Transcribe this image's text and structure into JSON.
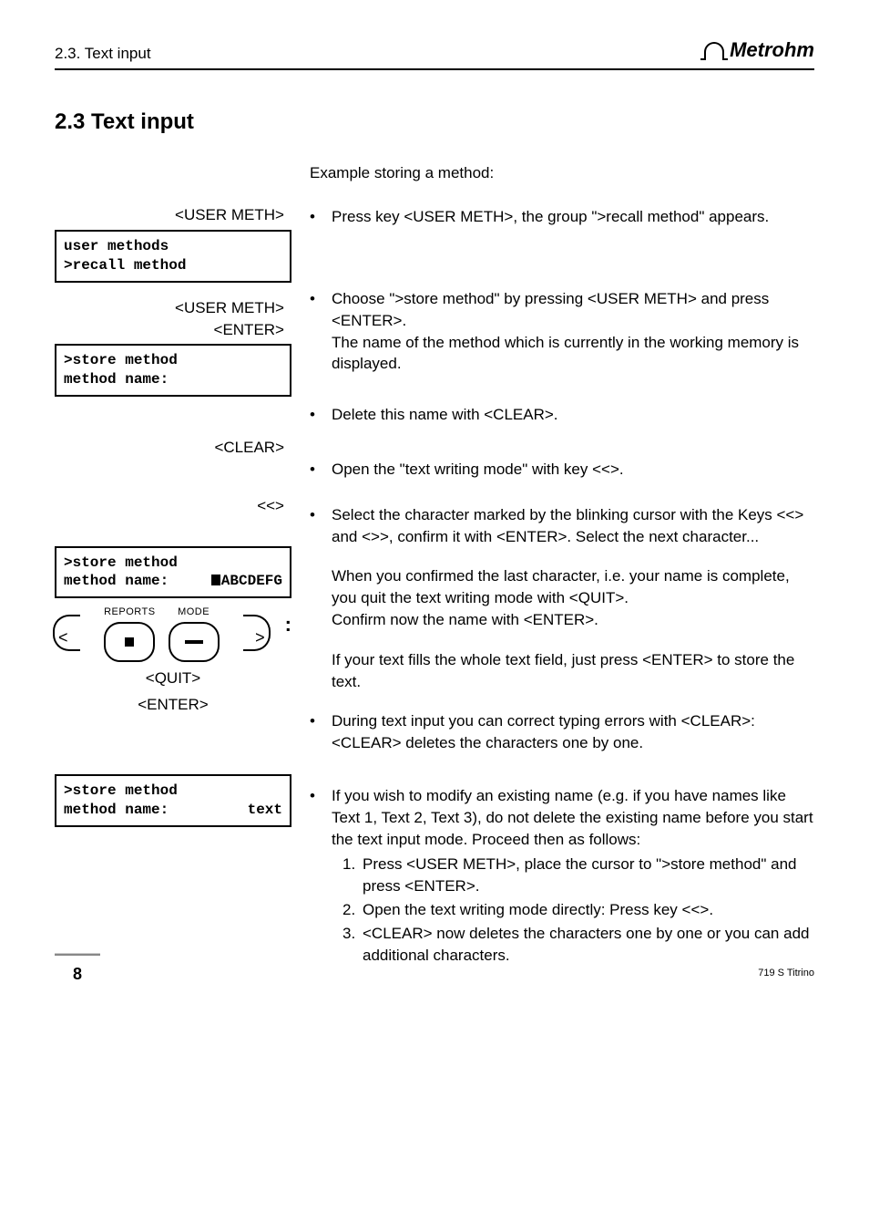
{
  "header": {
    "section_ref": "2.3. Text input",
    "brand": "Metrohm"
  },
  "section": {
    "number": "2.3",
    "title": "Text input"
  },
  "intro": "Example storing a method:",
  "leftSteps": {
    "key1": "<USER METH>",
    "display1_line1": "user methods",
    "display1_line2": ">recall method",
    "key2_line1": "<USER METH>",
    "key2_line2": "<ENTER>",
    "display2_line1": ">store method",
    "display2_line2": "method name:",
    "key3": "<CLEAR>",
    "key4": "<<>",
    "display3_line1": ">store method",
    "display3_line2_left": "method name:",
    "display3_line2_right": "ABCDEFG",
    "keypad": {
      "left_label": "REPORTS",
      "right_label": "MODE"
    },
    "key5_line1": "<QUIT>",
    "key5_line2": "<ENTER>",
    "display4_line1": ">store method",
    "display4_line2_left": "method name:",
    "display4_line2_right": "text"
  },
  "bullets": {
    "b1": "Press key <USER METH>, the group \">recall method\" appears.",
    "b2": "Choose \">store method\" by pressing <USER METH> and press <ENTER>.\nThe name of the method which is currently in the working memory is displayed.",
    "b3": "Delete this name with <CLEAR>.",
    "b4": "Open the \"text writing mode\" with key <<>.",
    "b5_p1": "Select the character marked by the blinking cursor with the Keys <<> and <>>, confirm it with <ENTER>. Select the next character...",
    "b5_p2": "When you confirmed the last character, i.e. your name is complete, you quit the text writing mode with <QUIT>.\nConfirm now the name with <ENTER>.",
    "b5_p3": "If your text fills the whole text field, just press <ENTER> to store the text.",
    "b6": "During text input you can correct typing errors with <CLEAR>:\n<CLEAR> deletes the characters one by one.",
    "b7_intro": "If you wish to modify an existing name (e.g. if you have names like Text 1, Text 2, Text 3), do not delete the existing name before you start the text input mode. Proceed then as follows:",
    "b7_items": {
      "n1": "1.",
      "t1": "Press <USER METH>, place the cursor to \">store method\" and press <ENTER>.",
      "n2": "2.",
      "t2": "Open the text writing mode directly: Press key <<>.",
      "n3": "3.",
      "t3": "<CLEAR> now deletes the characters one by one or you can add additional characters."
    }
  },
  "footer": {
    "page": "8",
    "doc": "719 S Titrino"
  }
}
